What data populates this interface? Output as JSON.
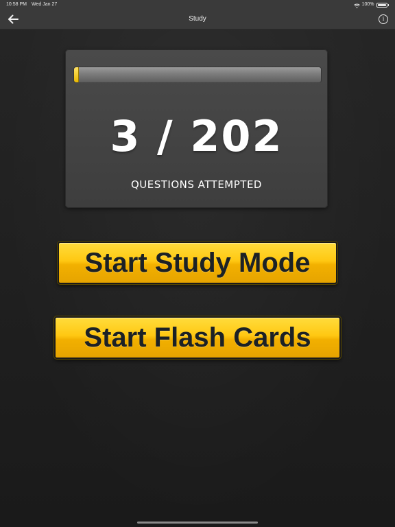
{
  "status_bar": {
    "time": "10:58 PM",
    "date": "Wed Jan 27",
    "battery": "100%"
  },
  "nav": {
    "title": "Study",
    "back_icon": "arrow-left-icon",
    "info_icon": "info-icon",
    "info_glyph": "i"
  },
  "progress": {
    "count_text": "3 / 202",
    "attempted": 3,
    "total": 202,
    "fill_fraction": 0.015,
    "caption": "QUESTIONS ATTEMPTED",
    "fill_color": "#f5c400"
  },
  "buttons": {
    "study_mode": "Start Study Mode",
    "flash_cards": "Start Flash Cards"
  },
  "colors": {
    "accent": "#ffc812",
    "background": "#1f1f1f",
    "bar": "#3a3a3a"
  }
}
